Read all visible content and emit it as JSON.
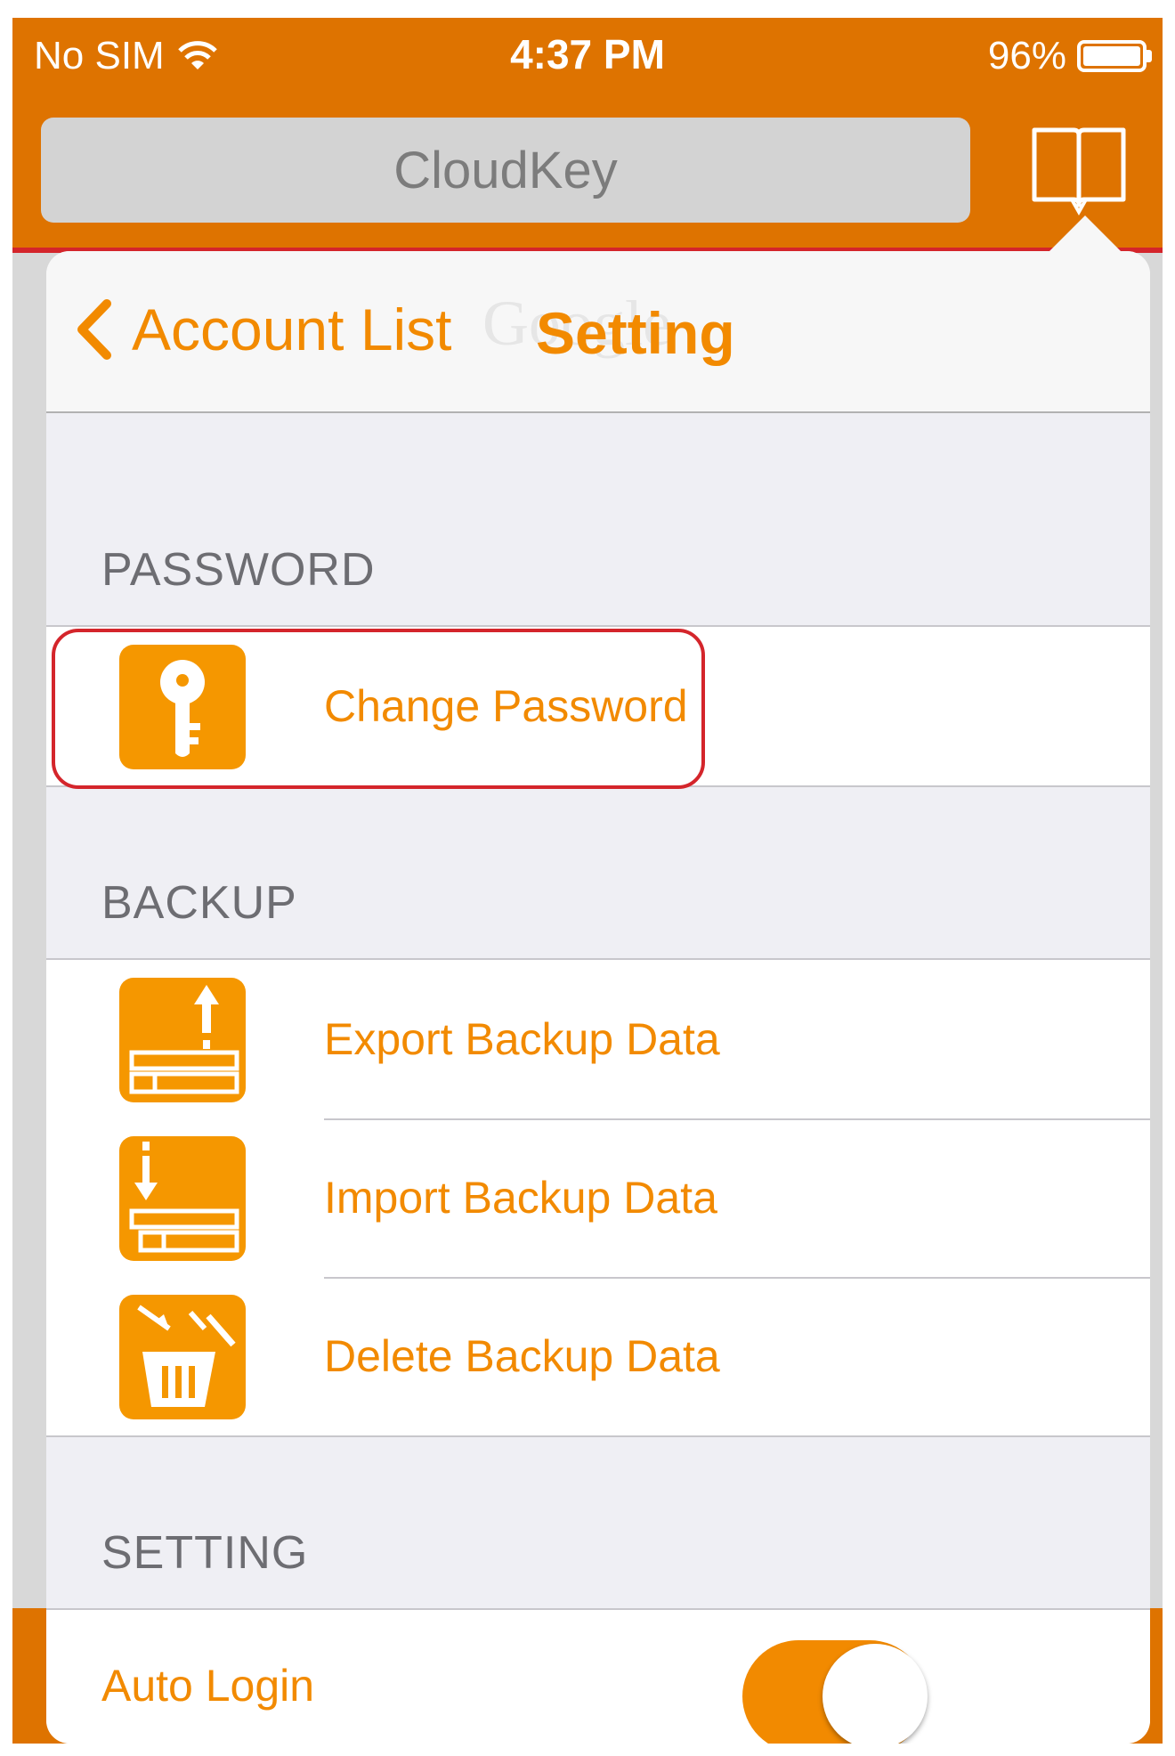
{
  "status_bar": {
    "carrier": "No SIM",
    "time": "4:37 PM",
    "battery": "96%"
  },
  "search": {
    "placeholder": "CloudKey"
  },
  "nav": {
    "back_label": "Account List",
    "title": "Setting",
    "ghost_text": "Google"
  },
  "sections": {
    "password": {
      "header": "PASSWORD",
      "items": [
        {
          "label": "Change Password",
          "icon": "key-icon"
        }
      ]
    },
    "backup": {
      "header": "BACKUP",
      "items": [
        {
          "label": "Export Backup Data",
          "icon": "export-icon"
        },
        {
          "label": "Import Backup Data",
          "icon": "import-icon"
        },
        {
          "label": "Delete Backup Data",
          "icon": "trash-icon"
        }
      ]
    },
    "setting": {
      "header": "SETTING",
      "items": [
        {
          "label": "Auto Login",
          "toggle_on": true
        }
      ]
    }
  },
  "colors": {
    "accent": "#f28a00",
    "header": "#de7300",
    "icon_tile": "#f59700",
    "highlight": "#d4252b"
  }
}
